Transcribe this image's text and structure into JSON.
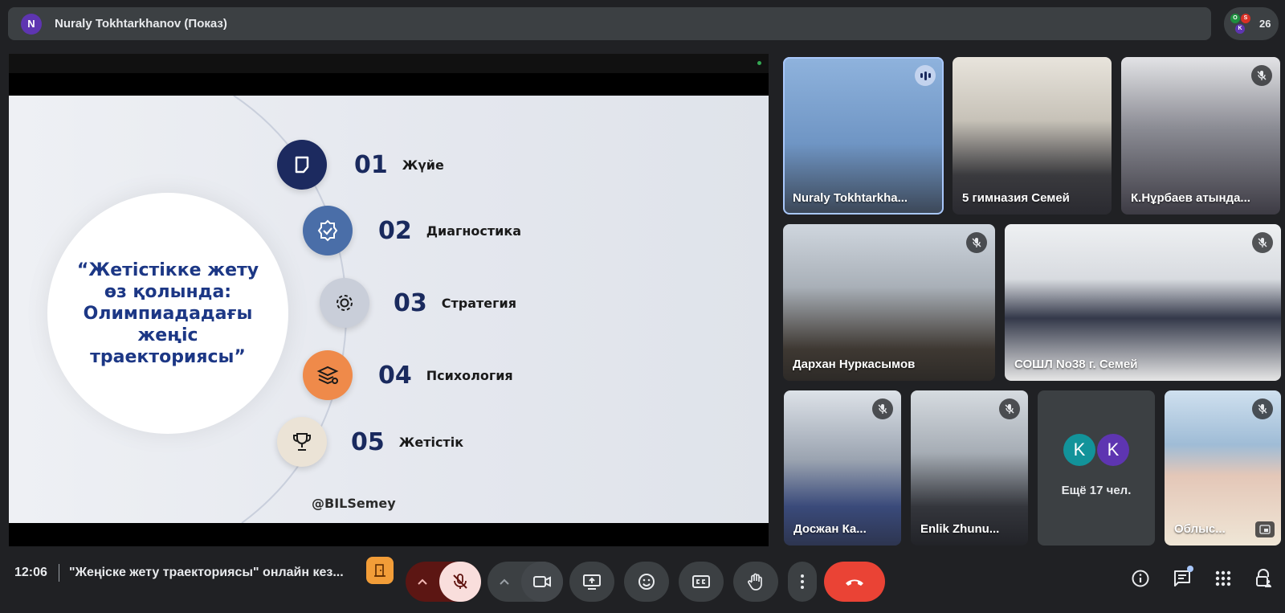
{
  "topbar": {
    "presenter_initial": "N",
    "presenter_label": "Nuraly Tokhtarkhanov (Показ)",
    "people_avatars": [
      "O",
      "S",
      "K"
    ],
    "people_count": "26"
  },
  "slide": {
    "title": "“Жетістікке жету өз қолында: Олимпиададағы жеңіс траекториясы”",
    "steps": [
      {
        "num": "01",
        "label": "Жүйе",
        "icon": "bookmark-icon",
        "color": "#1c2a5f"
      },
      {
        "num": "02",
        "label": "Диагностика",
        "icon": "badge-check-icon",
        "color": "#4a6ea8"
      },
      {
        "num": "03",
        "label": "Стратегия",
        "icon": "gear-icon",
        "color": "#c9ced9"
      },
      {
        "num": "04",
        "label": "Психология",
        "icon": "book-stack-icon",
        "color": "#ef8a4a"
      },
      {
        "num": "05",
        "label": "Жетістік",
        "icon": "trophy-icon",
        "color": "#ebe3d6"
      }
    ],
    "handle": "@BILSemey"
  },
  "participants": [
    {
      "name": "Nuraly Tokhtarkha...",
      "state": "speaking"
    },
    {
      "name": "5 гимназия Семей",
      "state": "none"
    },
    {
      "name": "К.Нұрбаев атында...",
      "state": "muted"
    },
    {
      "name": "Дархан Нуркасымов",
      "state": "muted"
    },
    {
      "name": "СОШЛ No38 г. Семей",
      "state": "muted"
    },
    {
      "name": "Досжан Ка...",
      "state": "muted"
    },
    {
      "name": "Enlik Zhunu...",
      "state": "muted"
    },
    {
      "name": "Облыс...",
      "state": "muted"
    }
  ],
  "more_tile": {
    "avatars": [
      {
        "letter": "K",
        "color": "#12939a"
      },
      {
        "letter": "K",
        "color": "#5e35b1"
      }
    ],
    "text": "Ещё 17 чел."
  },
  "bottombar": {
    "time": "12:06",
    "meeting_title": "\"Жеңіске жету траекториясы\" онлайн кез..."
  },
  "colors": {
    "end_call": "#ea4335",
    "mic_off_bg": "#f9dedc",
    "accent": "#a8c7fa"
  }
}
